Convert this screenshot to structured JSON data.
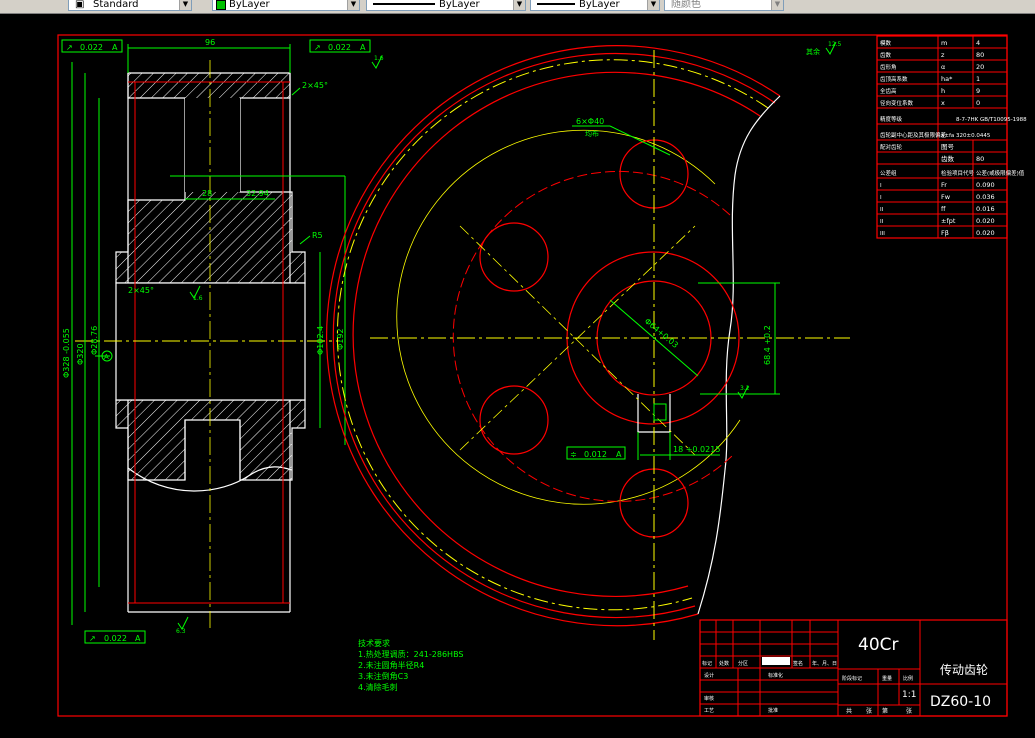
{
  "toolbar": {
    "text_style": "Standard",
    "layer": "ByLayer",
    "linetype": "ByLayer",
    "lineweight": "ByLayer",
    "plot_style": "随颜色",
    "layer_color": "#00c000"
  },
  "dims": {
    "runout_top_left": "0.022",
    "runout_top_right": "0.022",
    "runout_bottom": "0.022",
    "datum": "A",
    "width_96": "96",
    "chamfer_top": "2×45°",
    "chamfer_hub": "2×45°",
    "web_28": "28",
    "hub_3294": "32.94",
    "fillet_r5": "R5",
    "d_328": "Φ328 -0.055",
    "d_320": "Φ320",
    "d_2876": "Φ28.76",
    "d_1024": "Φ102.4",
    "d_192": "Φ192",
    "rough_12_5": "12.5",
    "rough_1_6": "1.6",
    "rough_3_2": "3.2",
    "rough_6_3": "6.3",
    "holes": "6×Φ40",
    "holes_note": "均布",
    "bore": "Φ64+0.03",
    "keyway_depth": "68.4 +0.2",
    "keyway_width": "18 +0.0215",
    "symmetry": "0.012",
    "other_rough": "其余"
  },
  "gear_table": [
    [
      "模数",
      "m",
      "4"
    ],
    [
      "齿数",
      "z",
      "80"
    ],
    [
      "齿形角",
      "α",
      "20"
    ],
    [
      "齿顶高系数",
      "ha*",
      "1"
    ],
    [
      "全齿高",
      "h",
      "9"
    ],
    [
      "径向变位系数",
      "x",
      "0"
    ],
    [
      "精度等级",
      "",
      "8-7-7HK GB/T10095-1988"
    ],
    [
      "齿轮副中心距及其极限偏差",
      "a±fa",
      "320±0.0445"
    ],
    [
      "配对齿轮",
      "图号",
      ""
    ],
    [
      "",
      "齿数",
      "80"
    ],
    [
      "公差组",
      "检验项目代号",
      "公差(或极限偏差)值"
    ],
    [
      "I",
      "Fr",
      "0.090"
    ],
    [
      "I",
      "Fw",
      "0.036"
    ],
    [
      "II",
      "ff",
      "0.016"
    ],
    [
      "II",
      "±fpt",
      "0.020"
    ],
    [
      "III",
      "Fβ",
      "0.020"
    ]
  ],
  "tech_notes": {
    "title": "技术要求",
    "items": [
      "1.热处理调质：241-286HBS",
      "2.未注圆角半径R4",
      "3.未注倒角C3",
      "4.清除毛刺"
    ]
  },
  "title_block": {
    "material": "40Cr",
    "part_name": "传动齿轮",
    "drawing_no": "DZ60-10",
    "scale": "1:1",
    "row_labels": [
      "标记",
      "处数",
      "分区",
      "更改文件号",
      "签名",
      "年、月、日"
    ],
    "design": "设计",
    "standardize": "标准化",
    "stage_mark": "阶段标记",
    "weight": "重量",
    "scale_label": "比例",
    "review": "审核",
    "process": "工艺",
    "approve": "批准",
    "total": "共",
    "sheets": "张",
    "sheet": "第",
    "sheet_unit": "张"
  },
  "colors": {
    "red": "#ff0000",
    "yellow": "#ffff00",
    "green": "#00ff00",
    "white": "#ffffff"
  }
}
